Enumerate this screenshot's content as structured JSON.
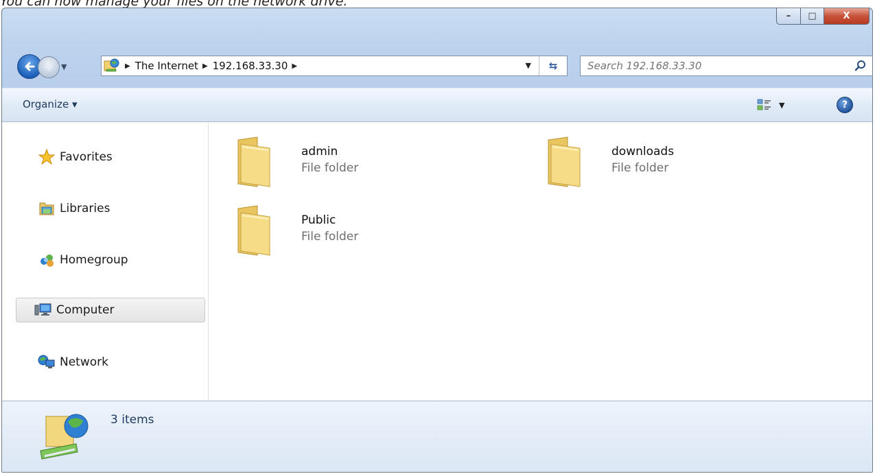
{
  "caption": "You can now manage your files on the network drive.",
  "window": {
    "controls": {
      "minimize": "–",
      "maximize": "□",
      "close": "X"
    }
  },
  "address_bar": {
    "breadcrumbs": [
      "The Internet",
      "192.168.33.30"
    ],
    "location_icon": "network-location-icon"
  },
  "search": {
    "placeholder": "Search 192.168.33.30"
  },
  "toolbar": {
    "organize_label": "Organize ▾"
  },
  "nav_pane": {
    "items": [
      {
        "label": "Favorites",
        "icon": "star-icon"
      },
      {
        "label": "Libraries",
        "icon": "libraries-icon"
      },
      {
        "label": "Homegroup",
        "icon": "homegroup-icon"
      },
      {
        "label": "Computer",
        "icon": "computer-icon",
        "selected": true
      },
      {
        "label": "Network",
        "icon": "network-icon"
      }
    ]
  },
  "folders": [
    {
      "name": "admin",
      "type": "File folder"
    },
    {
      "name": "downloads",
      "type": "File folder"
    },
    {
      "name": "Public",
      "type": "File folder"
    }
  ],
  "status_bar": {
    "item_count": "3 items"
  },
  "colors": {
    "frame": "#bcd3ee",
    "close": "#c8513a",
    "folder": "#f3d77c"
  }
}
